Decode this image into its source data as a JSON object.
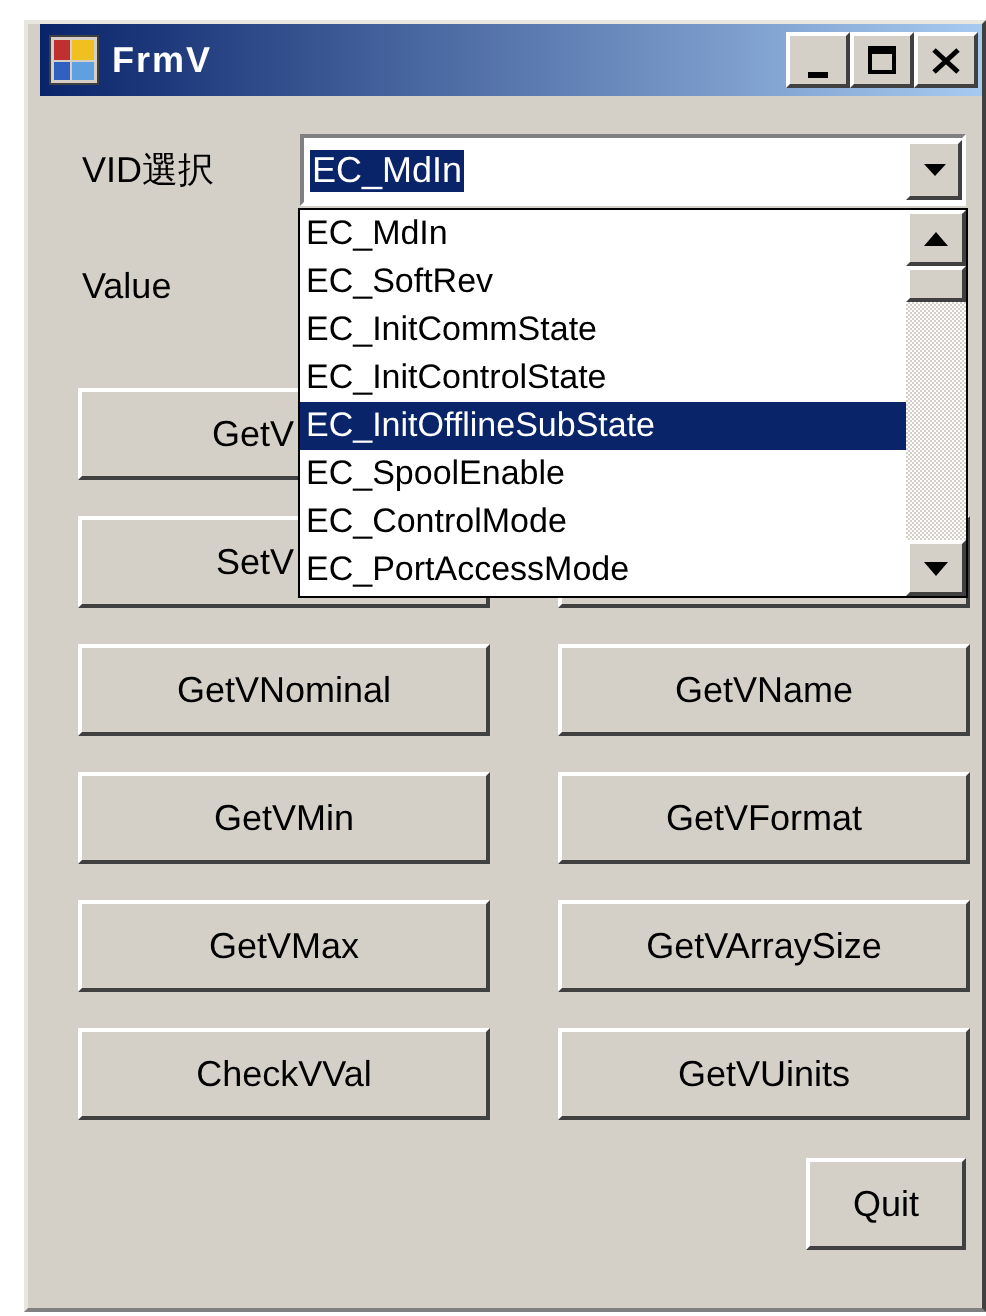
{
  "window": {
    "title": "FrmV"
  },
  "vid_select": {
    "label": "VID選択",
    "value": "EC_MdIn"
  },
  "value_field": {
    "label": "Value"
  },
  "dropdown": {
    "items": [
      {
        "label": "EC_MdIn",
        "selected": false
      },
      {
        "label": "EC_SoftRev",
        "selected": false
      },
      {
        "label": "EC_InitCommState",
        "selected": false
      },
      {
        "label": "EC_InitControlState",
        "selected": false
      },
      {
        "label": "EC_InitOfflineSubState",
        "selected": true
      },
      {
        "label": "EC_SpoolEnable",
        "selected": false
      },
      {
        "label": "EC_ControlMode",
        "selected": false
      },
      {
        "label": "EC_PortAccessMode",
        "selected": false
      }
    ]
  },
  "left_buttons": [
    "GetV",
    "SetV",
    "GetVNominal",
    "GetVMin",
    "GetVMax",
    "CheckVVal"
  ],
  "right_buttons": [
    "GetVName",
    "GetVFormat",
    "GetVArraySize",
    "GetVUinits"
  ],
  "quit_button": "Quit"
}
